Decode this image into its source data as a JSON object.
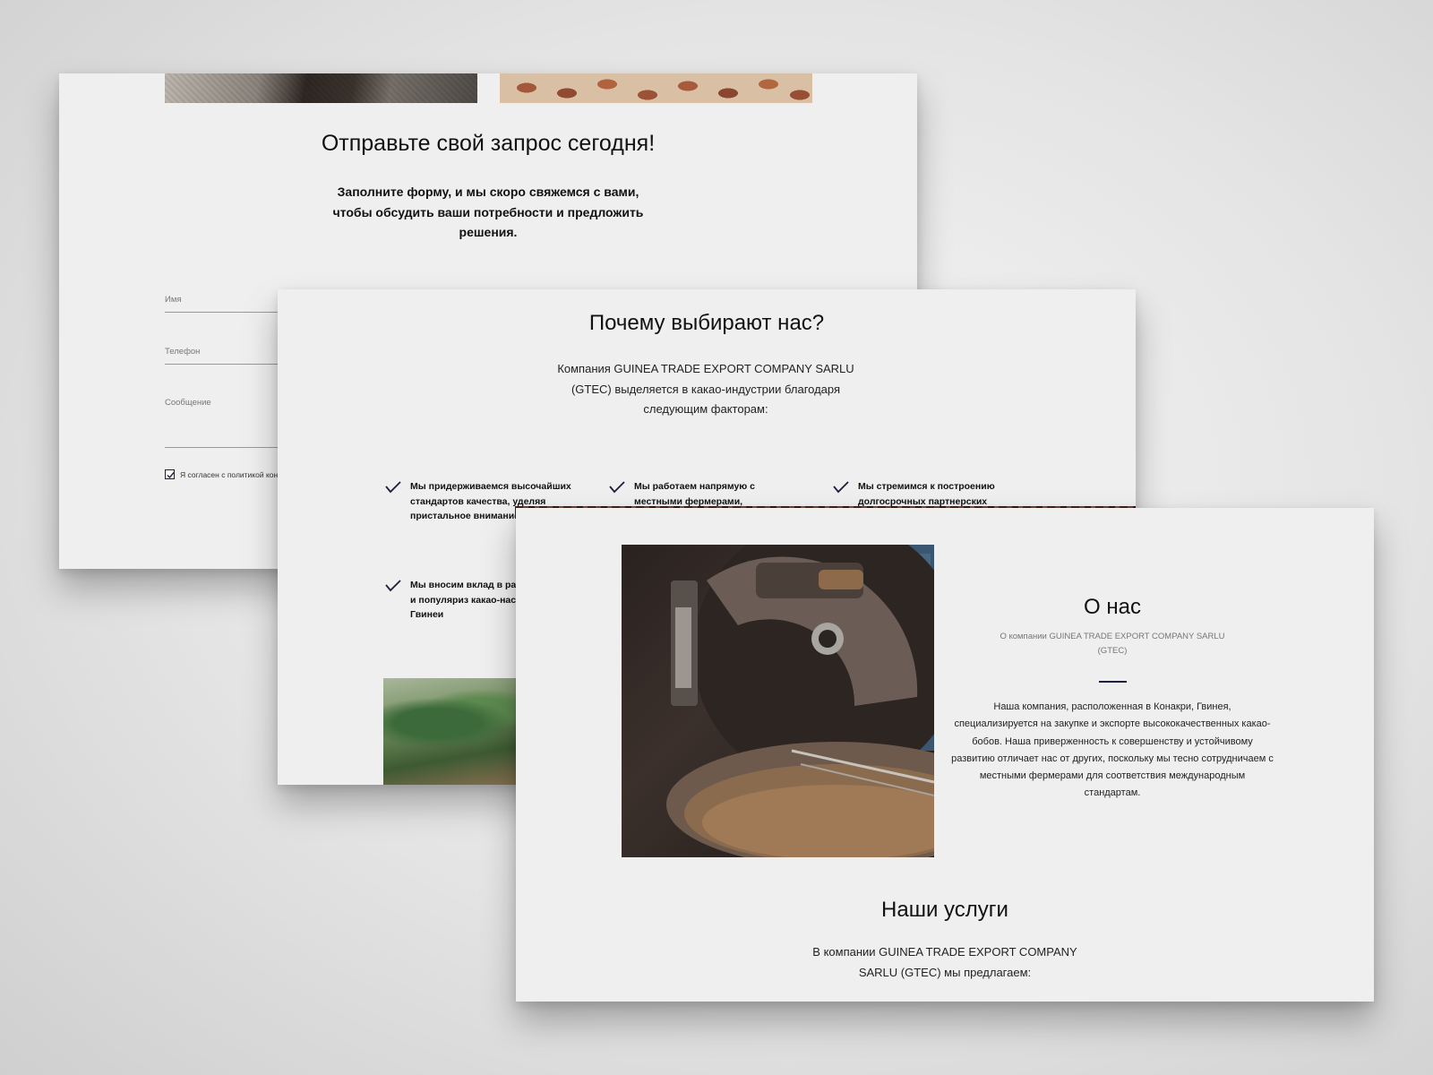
{
  "form_card": {
    "title": "Отправьте свой запрос сегодня!",
    "subtitle": "Заполните форму, и мы скоро свяжемся с вами, чтобы обсудить ваши потребности и предложить решения.",
    "fields": {
      "name_label": "Имя",
      "phone_label": "Телефон",
      "message_label": "Сообщение"
    },
    "consent": {
      "checked": true,
      "label": "Я согласен с политикой кон"
    }
  },
  "why_card": {
    "title": "Почему выбирают нас?",
    "description": "Компания GUINEA TRADE EXPORT COMPANY SARLU (GTEC) выделяется в какао-индустрии благодаря следующим факторам:",
    "features": [
      "Мы придерживаемся высочайших стандартов качества, уделяя пристальное внимание детали.",
      "Мы работаем напрямую с местными фермерами, поддерживая",
      "Мы стремимся к построению долгосрочных партнерских",
      "Мы вносим вклад в раз сообществ и популяриз какао-наследие Гвинеи"
    ]
  },
  "about_card": {
    "title": "О нас",
    "subtitle": "О компании GUINEA TRADE EXPORT COMPANY SARLU (GTEC)",
    "text": "Наша компания, расположенная в Конакри, Гвинея, специализируется на закупке и экспорте высококачественных какао-бобов. Наша приверженность к совершенству и устойчивому развитию отличает нас от других, поскольку мы тесно сотрудничаем с местными фермерами для соответствия международным стандартам.",
    "services_title": "Наши услуги",
    "services_desc": "В компании GUINEA TRADE EXPORT COMPANY SARLU (GTEC) мы предлагаем:"
  },
  "colors": {
    "accent": "#1d1f3f",
    "card_bg": "#efefef"
  }
}
